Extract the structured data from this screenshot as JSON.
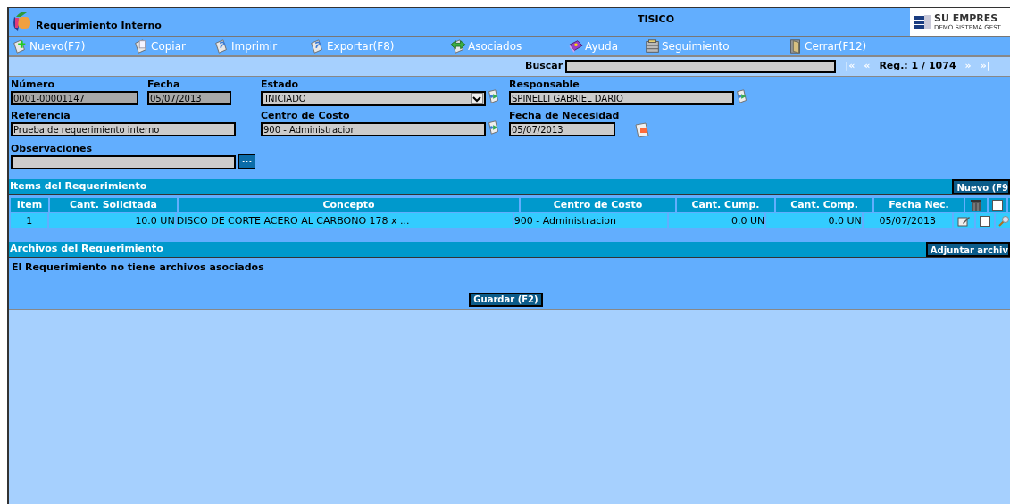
{
  "window": {
    "title": "Requerimiento Interno",
    "company": "TISICO",
    "logo": {
      "name": "SU EMPRES",
      "tagline": "DEMO SISTEMA GEST"
    }
  },
  "toolbar": [
    {
      "label": "Nuevo(F7)",
      "kind": "new"
    },
    {
      "label": "Copiar",
      "kind": "copy"
    },
    {
      "label": "Imprimir",
      "kind": "print"
    },
    {
      "label": "Exportar(F8)",
      "kind": "export"
    },
    {
      "label": "Asociados",
      "kind": "link"
    },
    {
      "label": "Ayuda",
      "kind": "help"
    },
    {
      "label": "Seguimiento",
      "kind": "track"
    },
    {
      "label": "Cerrar(F12)",
      "kind": "close"
    }
  ],
  "search": {
    "label": "Buscar",
    "nav": [
      "|«",
      "«",
      "Reg.: 1 / 1074",
      "»",
      "»|"
    ]
  },
  "form": [
    [
      {
        "label": "Número",
        "value": "0001-00001147",
        "readonly": true,
        "kind": "text"
      },
      {
        "label": "Fecha",
        "value": "05/07/2013",
        "readonly": true,
        "kind": "text"
      },
      {
        "label": "Estado",
        "value": "INICIADO",
        "readonly": false,
        "kind": "select",
        "action": {
          "kind": "lookup"
        }
      },
      {
        "label": "Responsable",
        "value": "SPINELLI GABRIEL DARIO",
        "readonly": false,
        "kind": "text",
        "action": {
          "kind": "lookup"
        }
      }
    ],
    [
      {
        "label": "Referencia",
        "value": "Prueba de requerimiento interno",
        "readonly": false,
        "kind": "text"
      },
      {
        "label": "Centro de Costo",
        "value": "900 - Administracion",
        "readonly": false,
        "kind": "text",
        "action": {
          "kind": "lookup"
        }
      },
      {
        "label": "Fecha de Necesidad",
        "value": "05/07/2013",
        "readonly": false,
        "kind": "text",
        "action": {
          "kind": "calendar"
        }
      }
    ],
    [
      {
        "label": "Observaciones",
        "readonly": false,
        "kind": "text",
        "action": {
          "kind": "more",
          "label": "..."
        }
      }
    ]
  ],
  "items": {
    "title": "Items del Requerimiento",
    "button": "Nuevo (F9",
    "columns": [
      "Item",
      "Cant. Solicitada",
      "Concepto",
      "Centro de Costo",
      "Cant. Cump.",
      "Cant. Comp.",
      "Fecha Nec."
    ],
    "select_all": {
      "checked": false
    },
    "rows": [
      {
        "cells": [
          "1",
          "10.0 UN",
          "DISCO DE CORTE ACERO AL CARBONO 178 x ...",
          "900 - Administracion",
          "0.0 UN",
          "0.0 UN",
          "05/07/2013"
        ],
        "checked": false
      }
    ]
  },
  "files": {
    "title": "Archivos del Requerimiento",
    "button": "Adjuntar archiv",
    "message": "El Requerimiento no tiene archivos asociados"
  },
  "save_button": "Guardar (F2)"
}
